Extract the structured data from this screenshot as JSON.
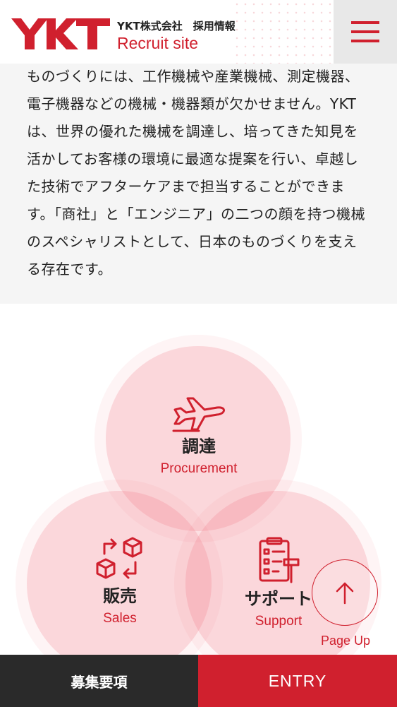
{
  "header": {
    "logo_text": "YKT",
    "brand_name": "YKT株式会社　採用情報",
    "brand_sub": "Recruit site",
    "menu_icon": "hamburger-icon"
  },
  "intro": {
    "text": "ものづくりには、工作機械や産業機械、測定機器、電子機器などの機械・機器類が欠かせません。YKTは、世界の優れた機械を調達し、培ってきた知見を活かしてお客様の環境に最適な提案を行い、卓越した技術でアフターケアまで担当することができます。「商社」と「エンジニア」の二つの顔を持つ機械のスペシャリストとして、日本のものづくりを支える存在です。"
  },
  "business": [
    {
      "label_ja": "調達",
      "label_en": "Procurement",
      "icon": "airplane-icon"
    },
    {
      "label_ja": "販売",
      "label_en": "Sales",
      "icon": "boxes-exchange-icon"
    },
    {
      "label_ja": "サポート",
      "label_en": "Support",
      "icon": "checklist-hammer-icon"
    }
  ],
  "page_up": {
    "label": "Page Up",
    "icon": "arrow-up-icon"
  },
  "footer": {
    "recruit_label": "募集要項",
    "entry_label": "ENTRY"
  },
  "colors": {
    "accent": "#d0202e",
    "dark": "#2a2a2a",
    "intro_bg": "#f5f5f5"
  }
}
